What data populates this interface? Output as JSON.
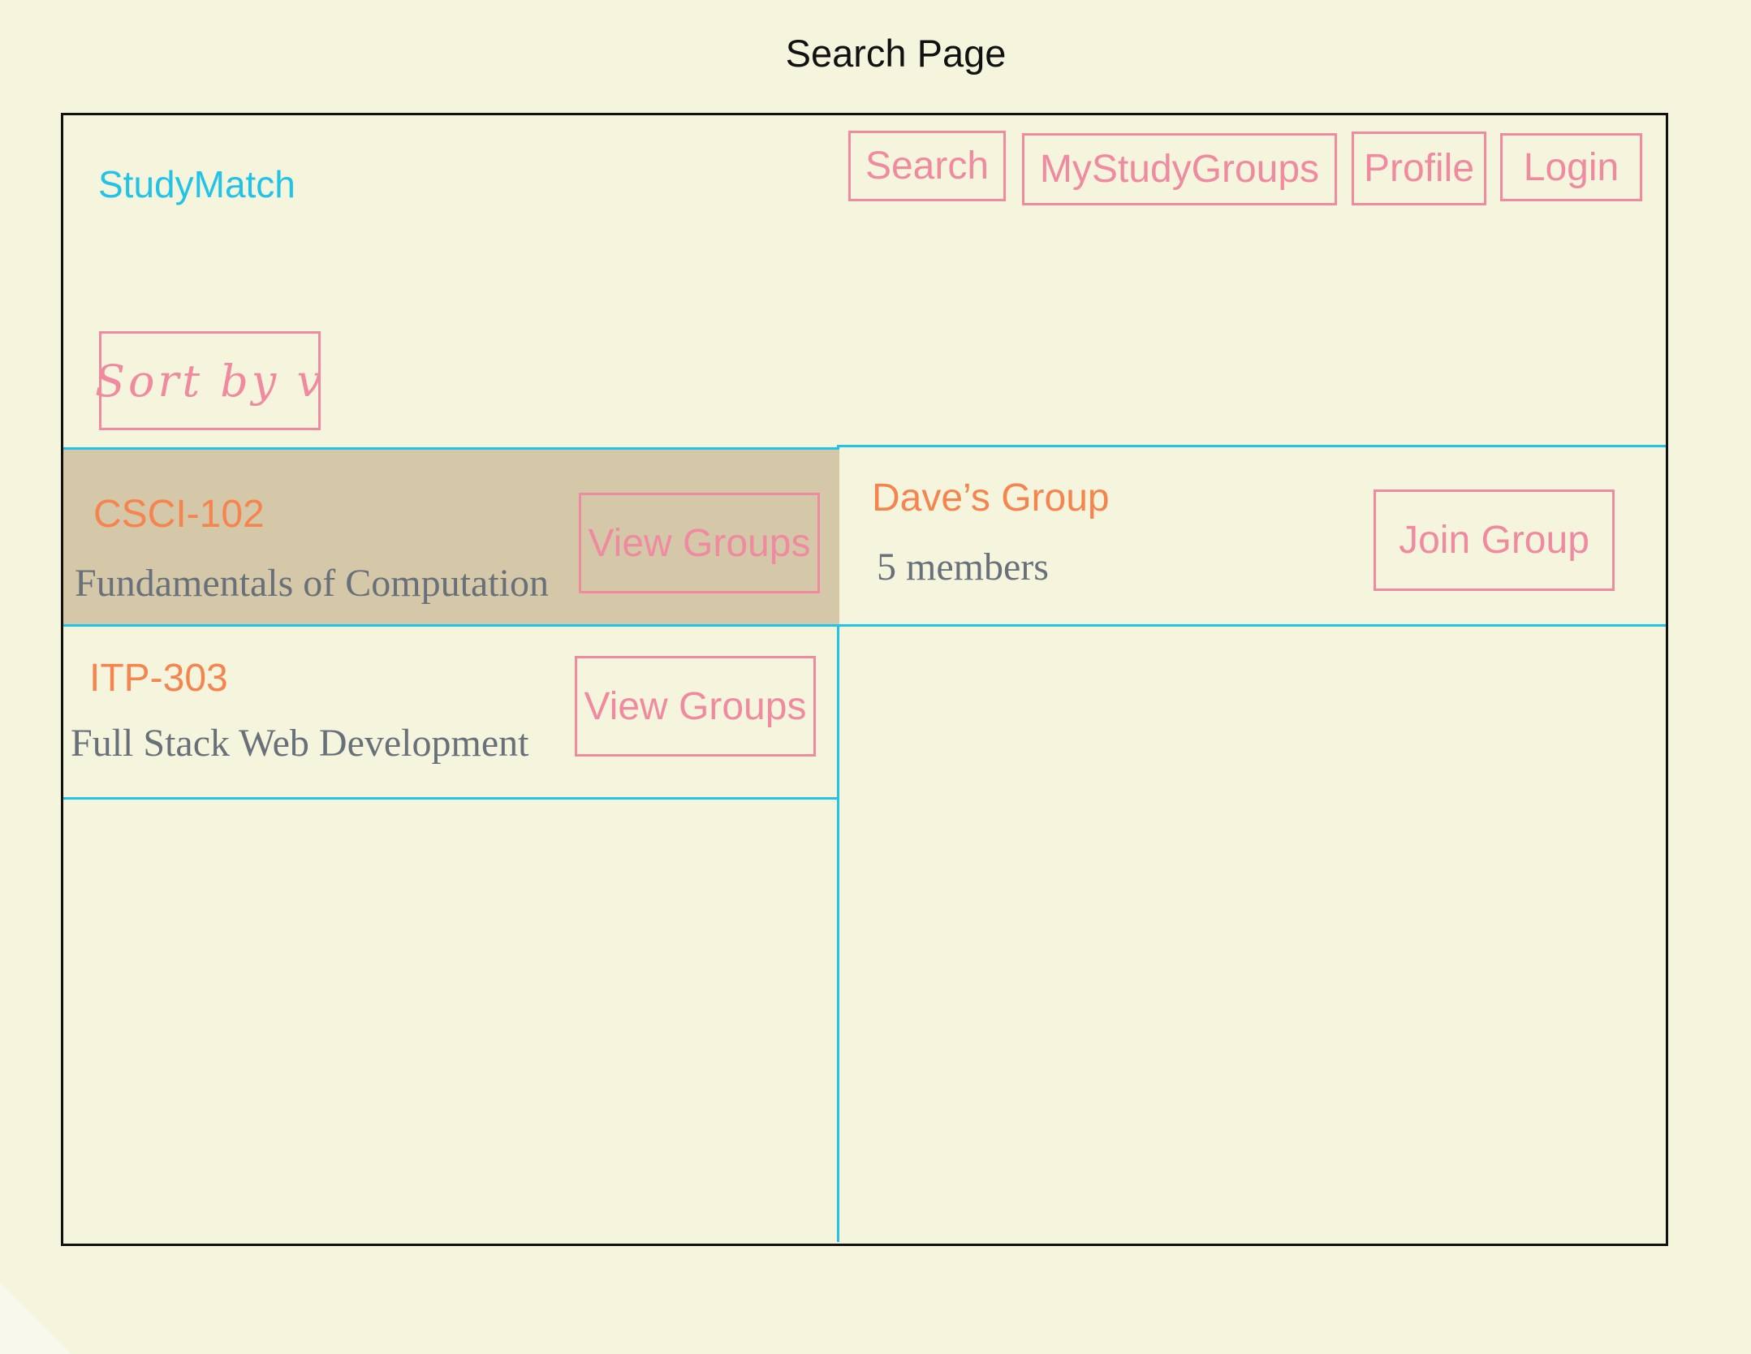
{
  "caption": "Search Page",
  "brand": "StudyMatch",
  "nav": {
    "search": "Search",
    "my_study_groups": "MyStudyGroups",
    "profile": "Profile",
    "login": "Login"
  },
  "sort": {
    "label": "Sort by v"
  },
  "courses": [
    {
      "code": "CSCI-102",
      "name": "Fundamentals of Computation",
      "action": "View Groups",
      "selected": true
    },
    {
      "code": "ITP-303",
      "name": "Full Stack Web Development",
      "action": "View Groups",
      "selected": false
    }
  ],
  "groups": [
    {
      "name": "Dave’s Group",
      "members": "5 members",
      "action": "Join Group"
    }
  ],
  "colors": {
    "background": "#f5f5de",
    "brand": "#22c3e6",
    "accent_box": "#f08aa0",
    "title_orange": "#f5844e",
    "selected_row": "#d4c8a8",
    "divider": "#22c3e6"
  }
}
